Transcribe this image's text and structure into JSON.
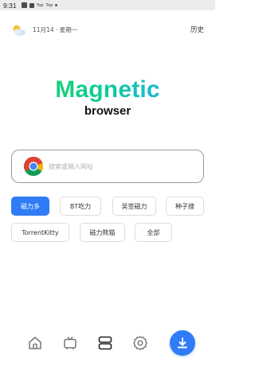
{
  "status_bar": {
    "time": "9:31",
    "tag_left": "Top",
    "tag_right": "Top"
  },
  "header": {
    "weather_icon": "partly-cloudy-icon",
    "date": "11月14 · 星期一",
    "history_label": "历史"
  },
  "logo": {
    "title": "Magnetic",
    "subtitle": "browser"
  },
  "search": {
    "engine_icon": "chrome-icon",
    "placeholder": "搜索或输入网址",
    "value": ""
  },
  "chips": [
    {
      "label": "磁力多",
      "active": true
    },
    {
      "label": "BT吃力",
      "active": false
    },
    {
      "label": "吴签磁力",
      "active": false
    },
    {
      "label": "种子搜",
      "active": false
    },
    {
      "label": "TorrentKitty",
      "active": false
    },
    {
      "label": "磁力熊猫",
      "active": false
    },
    {
      "label": "全部",
      "active": false
    }
  ],
  "bottom_nav": {
    "items": [
      {
        "icon": "home-icon"
      },
      {
        "icon": "tv-icon"
      },
      {
        "icon": "tabs-icon"
      },
      {
        "icon": "settings-icon"
      },
      {
        "icon": "download-icon"
      }
    ]
  },
  "colors": {
    "accent": "#2f7cf6",
    "logo_green": "#16d47a",
    "logo_teal": "#1bb8d6"
  }
}
